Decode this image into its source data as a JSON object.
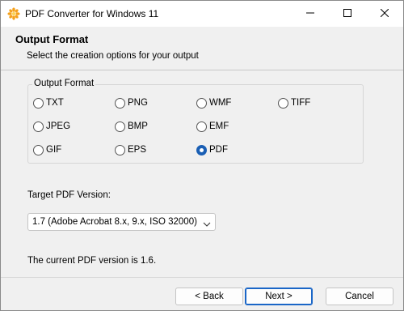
{
  "window": {
    "title": "PDF Converter for Windows 11",
    "icon": "sun-flower-icon"
  },
  "header": {
    "title": "Output Format",
    "subtitle": "Select the creation options for your output"
  },
  "output_format": {
    "group_label": "Output Format",
    "options": [
      {
        "label": "TXT",
        "selected": false
      },
      {
        "label": "PNG",
        "selected": false
      },
      {
        "label": "WMF",
        "selected": false
      },
      {
        "label": "TIFF",
        "selected": false
      },
      {
        "label": "JPEG",
        "selected": false
      },
      {
        "label": "BMP",
        "selected": false
      },
      {
        "label": "EMF",
        "selected": false
      },
      {
        "label": "GIF",
        "selected": false
      },
      {
        "label": "EPS",
        "selected": false
      },
      {
        "label": "PDF",
        "selected": true
      }
    ]
  },
  "pdf_version": {
    "label": "Target PDF Version:",
    "selected": "1.7 (Adobe Acrobat 8.x, 9.x, ISO 32000)",
    "current_note": "The current PDF version is 1.6."
  },
  "buttons": {
    "back": "< Back",
    "next": "Next >",
    "cancel": "Cancel"
  },
  "colors": {
    "accent": "#1a5fb4",
    "background": "#f0f0f0"
  }
}
